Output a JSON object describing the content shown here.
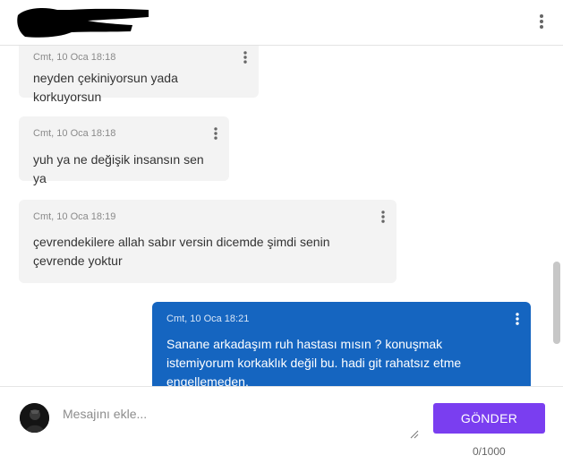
{
  "header": {
    "menu_icon": "more-vert-icon"
  },
  "messages": [
    {
      "direction": "in",
      "time": "Cmt, 10 Oca 18:18",
      "text": "neyden çekiniyorsun yada korkuyorsun"
    },
    {
      "direction": "in",
      "time": "Cmt, 10 Oca 18:18",
      "text": "yuh ya ne değişik insansın sen ya"
    },
    {
      "direction": "in",
      "time": "Cmt, 10 Oca 18:19",
      "text": "çevrendekilere allah sabır versin dicemde şimdi senin çevrende yoktur"
    },
    {
      "direction": "out",
      "time": "Cmt, 10 Oca 18:21",
      "text": "Sanane arkadaşım ruh hastası mısın ? konuşmak istemiyorum korkaklık değil bu. hadi git rahatsız etme engellemeden."
    }
  ],
  "compose": {
    "placeholder": "Mesajını ekle...",
    "value": "",
    "send_label": "GÖNDER",
    "counter": "0/1000"
  },
  "colors": {
    "outgoing_bubble": "#1565c0",
    "incoming_bubble": "#f3f3f3",
    "send_button": "#7a3ef0"
  }
}
